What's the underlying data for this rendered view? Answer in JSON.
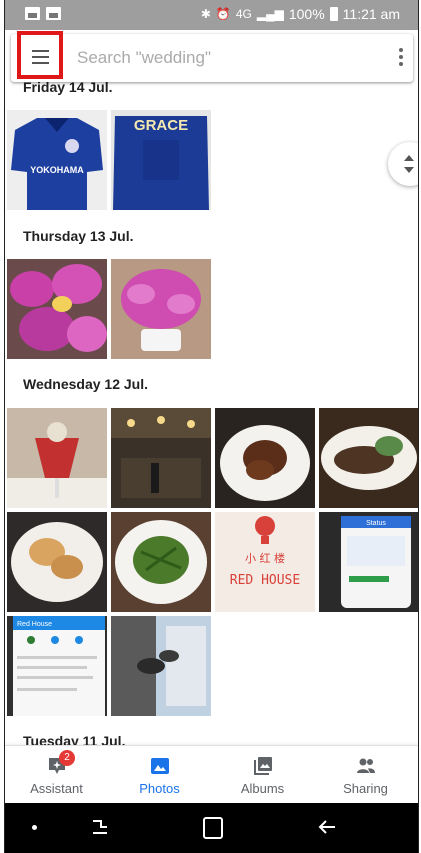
{
  "search": {
    "placeholder": "Search \"wedding\""
  },
  "status_bar": {
    "battery": "100%",
    "time": "11:21 am",
    "network": "4G"
  },
  "sections": [
    {
      "date": "Friday 14 Jul."
    },
    {
      "date": "Thursday 13 Jul."
    },
    {
      "date": "Wednesday 12 Jul."
    },
    {
      "date": "Tuesday 11 Jul."
    }
  ],
  "photos": {
    "shirt_text": "GRACE",
    "sponsor_text": "YOKOHAMA",
    "restaurant_line1": "小 红 楼",
    "restaurant_line2": "RED HOUSE",
    "phone_header": "Red House",
    "app_header": "Status"
  },
  "bottom_nav": [
    {
      "label": "Assistant",
      "icon": "assistant-icon",
      "badge": "2"
    },
    {
      "label": "Photos",
      "icon": "photos-icon",
      "active": true
    },
    {
      "label": "Albums",
      "icon": "albums-icon"
    },
    {
      "label": "Sharing",
      "icon": "sharing-icon"
    }
  ],
  "colors": {
    "accent": "#1a73e8",
    "highlight": "#e01818",
    "badge": "#e53935"
  }
}
